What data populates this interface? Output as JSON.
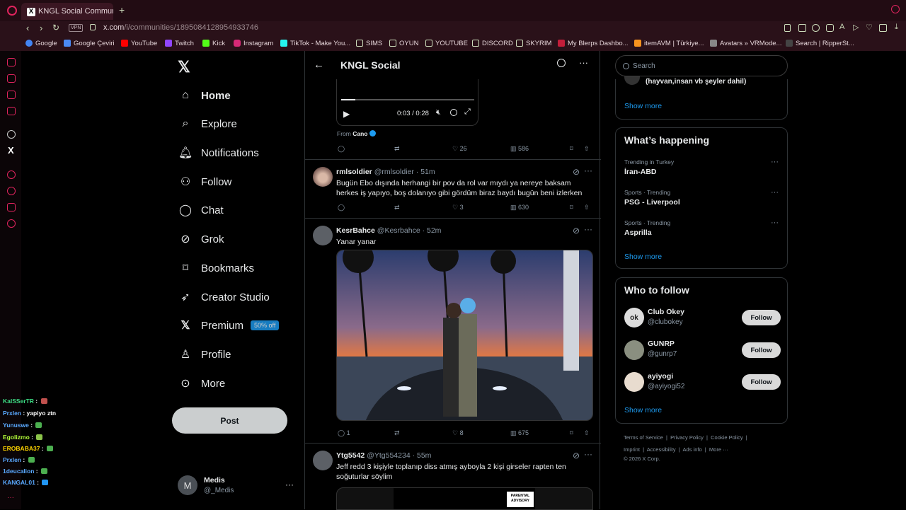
{
  "browser": {
    "tab_title": "KNGL Social Community /",
    "url_host": "x.com",
    "url_path": "/i/communities/1895084128954933746",
    "vpn": "VPN",
    "bookmarks": [
      "Google",
      "Google Çeviri",
      "YouTube",
      "Twitch",
      "Kick",
      "Instagram",
      "TikTok - Make You...",
      "SIMS",
      "OYUN",
      "YOUTUBE",
      "DISCORD",
      "SKYRIM",
      "My Blerps Dashbo...",
      "itemAVM | Türkiye...",
      "Avatars » VRMode...",
      "Search | RipperSt..."
    ]
  },
  "nav": {
    "items": [
      "Home",
      "Explore",
      "Notifications",
      "Follow",
      "Chat",
      "Grok",
      "Bookmarks",
      "Creator Studio",
      "Premium",
      "Profile",
      "More"
    ],
    "premium_badge": "50% off",
    "post_label": "Post",
    "user_name": "Medis",
    "user_handle": "@_Medis",
    "user_initial": "M"
  },
  "community": {
    "title": "KNGL Social"
  },
  "feed": {
    "audio_time": "0:03 / 0:28",
    "from_label": "From",
    "from_name": "Cano",
    "first_stats": {
      "replies": "",
      "likes": "26",
      "views": "586"
    },
    "tweets": [
      {
        "name": "rmlsoldier",
        "handle": "@rmlsoldier",
        "time": "· 51m",
        "text": "Bugün Ebo dışında herhangi bir pov da rol var mıydı ya nereye baksam herkes iş yapıyo, boş dolanıyo gibi gördüm biraz baydı bugün beni izlerken",
        "replies": "",
        "likes": "3",
        "views": "630"
      },
      {
        "name": "KesrBahce",
        "handle": "@Kesrbahce",
        "time": "· 52m",
        "text": "Yanar yanar",
        "replies": "1",
        "likes": "8",
        "views": "675"
      },
      {
        "name": "Ytg5542",
        "handle": "@Ytg554234",
        "time": "· 55m",
        "text": "Jeff redd 3 kişiyle toplanıp  diss atmış ayboyla 2 kişi girseler rapten ten soğuturlar söylim",
        "replies": "",
        "likes": "",
        "views": ""
      }
    ],
    "album_label": "PARENTAL ADVISORY"
  },
  "sidebar": {
    "search_placeholder": "Search",
    "top_snippet": "(hayvan,insan vb şeyler dahil)",
    "show_more": "Show more",
    "happening_title": "What’s happening",
    "trends": [
      {
        "cat": "Trending in Turkey",
        "name": "İran-ABD"
      },
      {
        "cat": "Sports · Trending",
        "name": "PSG - Liverpool"
      },
      {
        "cat": "Sports · Trending",
        "name": "Asprilla"
      }
    ],
    "who_title": "Who to follow",
    "who": [
      {
        "name": "Club Okey",
        "handle": "@clubokey"
      },
      {
        "name": "GUNRP",
        "handle": "@gunrp7"
      },
      {
        "name": "ayiyogi",
        "handle": "@ayiyogi52"
      }
    ],
    "follow_label": "Follow",
    "footer_line1": [
      "Terms of Service",
      "Privacy Policy",
      "Cookie Policy"
    ],
    "footer_line2": [
      "Imprint",
      "Accessibility",
      "Ads info",
      "More ···"
    ],
    "copyright": "© 2026 X Corp."
  },
  "stream_chat": [
    {
      "user": "KaISSerTR",
      "msg": " : ",
      "color": "#3ddc84"
    },
    {
      "user": "Prxlen",
      "msg": " : yapiyo ztn",
      "color": "#5aa9ff"
    },
    {
      "user": "Yunuswe",
      "msg": " : ",
      "color": "#5aa9ff"
    },
    {
      "user": "Egolizmo",
      "msg": " : ",
      "color": "#b6ff3a"
    },
    {
      "user": "EROBABA37",
      "msg": " : ",
      "color": "#ffd400"
    },
    {
      "user": "Prxlen",
      "msg": " : ",
      "color": "#5aa9ff"
    },
    {
      "user": "1deucalion",
      "msg": " : ",
      "color": "#5aa9ff"
    },
    {
      "user": "KANGAL01",
      "msg": " : ",
      "color": "#5aa9ff"
    }
  ]
}
